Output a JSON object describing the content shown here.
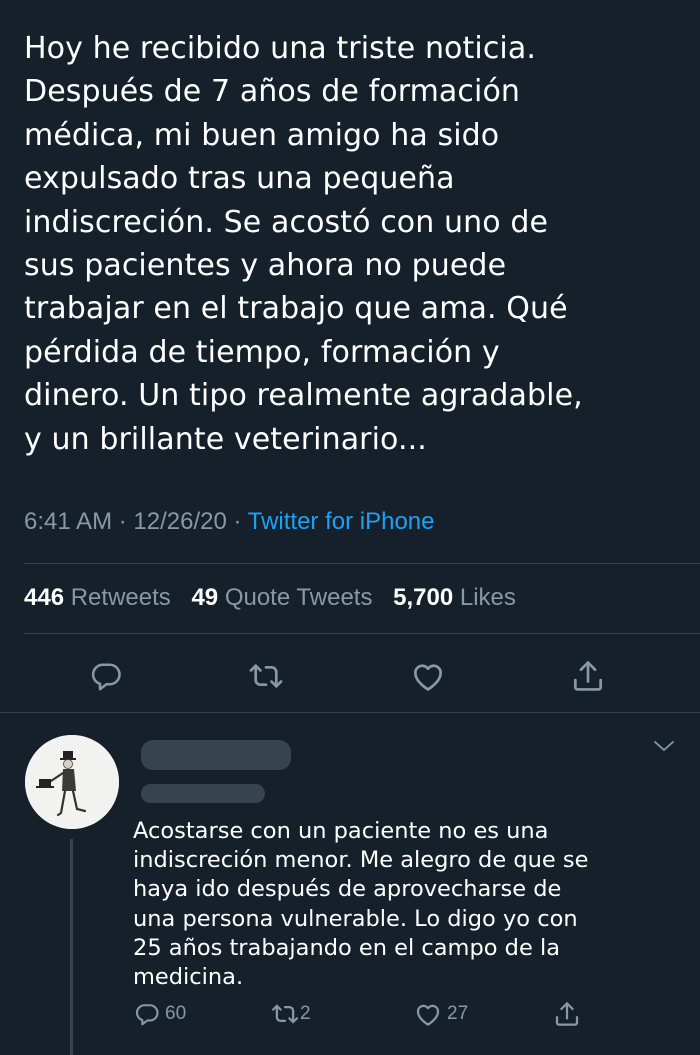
{
  "tweet": {
    "text": "Hoy he recibido una triste noticia.\nDespués de 7 años de formación\nmédica, mi buen amigo ha sido\nexpulsado tras una pequeña\nindiscreción. Se acostó con uno de\nsus pacientes y ahora no puede\ntrabajar en el trabajo que ama. Qué\npérdida de tiempo, formación y\ndinero. Un tipo realmente agradable,\ny un brillante veterinario...",
    "time": "6:41 AM",
    "date": "12/26/20",
    "separator": "·",
    "source": "Twitter for iPhone",
    "retweets_count": "446",
    "retweets_label": "Retweets",
    "quote_tweets_count": "49",
    "quote_tweets_label": "Quote Tweets",
    "likes_count": "5,700",
    "likes_label": "Likes"
  },
  "reply": {
    "text": "Acostarse con un paciente no es una\nindiscreción menor. Me alegro de que se\nhaya ido después de aprovecharse de\nuna persona vulnerable. Lo digo yo con\n25 años trabajando en el campo de la\nmedicina.",
    "reply_count": "60",
    "retweet_count": "2",
    "like_count": "27"
  },
  "icons": {
    "reply": "reply-icon",
    "retweet": "retweet-icon",
    "like": "heart-icon",
    "share": "share-icon",
    "menu": "chevron-down-icon"
  },
  "colors": {
    "background": "#15202b",
    "text": "#ffffff",
    "secondary": "#8899a6",
    "accent": "#1da1f2",
    "divider": "#38444d"
  }
}
